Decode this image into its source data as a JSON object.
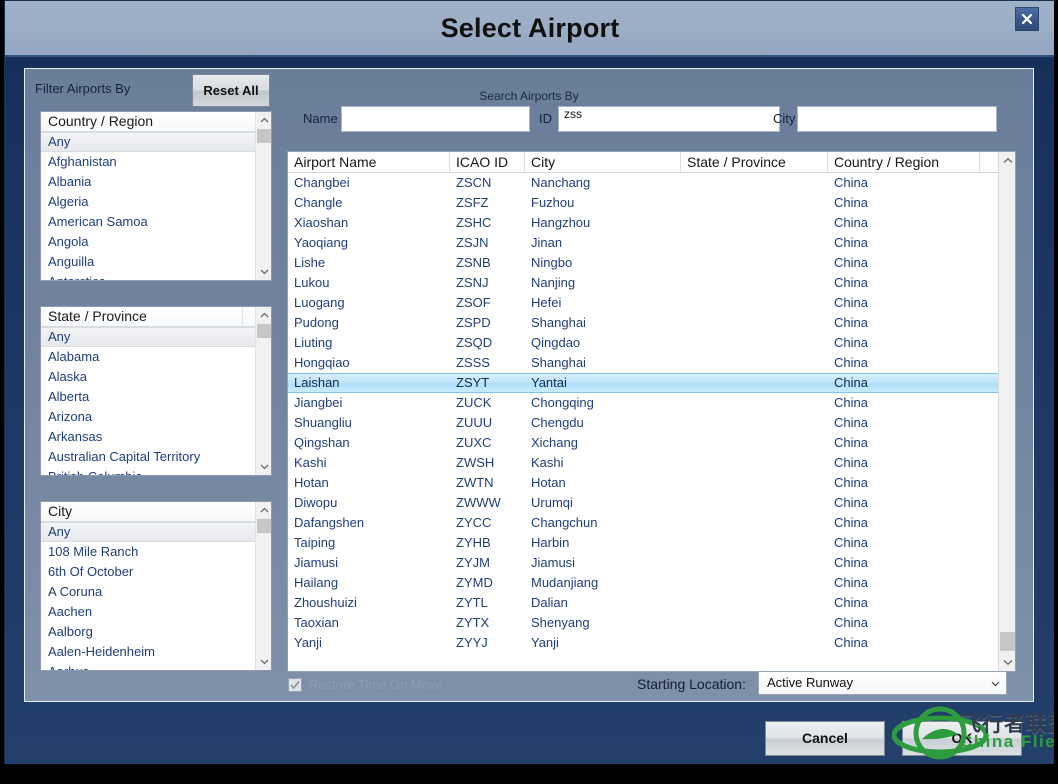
{
  "window": {
    "title": "Select Airport",
    "close_icon": "close-icon"
  },
  "filters": {
    "heading": "Filter Airports By",
    "reset_label": "Reset All",
    "lists": [
      {
        "header": "Country / Region",
        "selected": "Any",
        "items": [
          "Any",
          "Afghanistan",
          "Albania",
          "Algeria",
          "American Samoa",
          "Angola",
          "Anguilla",
          "Antarctica"
        ]
      },
      {
        "header": "State / Province",
        "selected": "Any",
        "items": [
          "Any",
          "Alabama",
          "Alaska",
          "Alberta",
          "Arizona",
          "Arkansas",
          "Australian Capital Territory",
          "British Columbia"
        ]
      },
      {
        "header": "City",
        "selected": "Any",
        "items": [
          "Any",
          "108 Mile Ranch",
          "6th Of October",
          "A Coruna",
          "Aachen",
          "Aalborg",
          "Aalen-Heidenheim",
          "Aarhus"
        ]
      }
    ]
  },
  "search": {
    "title": "Search Airports By",
    "name_label": "Name",
    "name_value": "",
    "id_label": "ID",
    "id_value": "zss",
    "city_label": "City",
    "city_value": ""
  },
  "table": {
    "columns": [
      "Airport Name",
      "ICAO ID",
      "City",
      "State / Province",
      "Country / Region"
    ],
    "selected_index": 10,
    "rows": [
      [
        "Changbei",
        "ZSCN",
        "Nanchang",
        "",
        "China"
      ],
      [
        "Changle",
        "ZSFZ",
        "Fuzhou",
        "",
        "China"
      ],
      [
        "Xiaoshan",
        "ZSHC",
        "Hangzhou",
        "",
        "China"
      ],
      [
        "Yaoqiang",
        "ZSJN",
        "Jinan",
        "",
        "China"
      ],
      [
        "Lishe",
        "ZSNB",
        "Ningbo",
        "",
        "China"
      ],
      [
        "Lukou",
        "ZSNJ",
        "Nanjing",
        "",
        "China"
      ],
      [
        "Luogang",
        "ZSOF",
        "Hefei",
        "",
        "China"
      ],
      [
        "Pudong",
        "ZSPD",
        "Shanghai",
        "",
        "China"
      ],
      [
        "Liuting",
        "ZSQD",
        "Qingdao",
        "",
        "China"
      ],
      [
        "Hongqiao",
        "ZSSS",
        "Shanghai",
        "",
        "China"
      ],
      [
        "Laishan",
        "ZSYT",
        "Yantai",
        "",
        "China"
      ],
      [
        "Jiangbei",
        "ZUCK",
        "Chongqing",
        "",
        "China"
      ],
      [
        "Shuangliu",
        "ZUUU",
        "Chengdu",
        "",
        "China"
      ],
      [
        "Qingshan",
        "ZUXC",
        "Xichang",
        "",
        "China"
      ],
      [
        "Kashi",
        "ZWSH",
        "Kashi",
        "",
        "China"
      ],
      [
        "Hotan",
        "ZWTN",
        "Hotan",
        "",
        "China"
      ],
      [
        "Diwopu",
        "ZWWW",
        "Urumqi",
        "",
        "China"
      ],
      [
        "Dafangshen",
        "ZYCC",
        "Changchun",
        "",
        "China"
      ],
      [
        "Taiping",
        "ZYHB",
        "Harbin",
        "",
        "China"
      ],
      [
        "Jiamusi",
        "ZYJM",
        "Jiamusi",
        "",
        "China"
      ],
      [
        "Hailang",
        "ZYMD",
        "Mudanjiang",
        "",
        "China"
      ],
      [
        "Zhoushuizi",
        "ZYTL",
        "Dalian",
        "",
        "China"
      ],
      [
        "Taoxian",
        "ZYTX",
        "Shenyang",
        "",
        "China"
      ],
      [
        "Yanji",
        "ZYYJ",
        "Yanji",
        "",
        "China"
      ]
    ]
  },
  "options": {
    "restore_time_label": "Restore Time On Move",
    "restore_time_checked": true,
    "starting_location_label": "Starting Location:",
    "starting_location_value": "Active Runway"
  },
  "footer": {
    "cancel_label": "Cancel",
    "ok_label": "OK"
  },
  "watermark": {
    "chinese": "飞行者联盟",
    "english": "China Flier",
    "color": "#2e9b3f"
  },
  "colors": {
    "title_bar": "#9cadc6",
    "window_body": "#1a3862",
    "content_panel": "#72849f",
    "selection_blue": "#ace0fa",
    "list_text": "#1f3f7a"
  }
}
